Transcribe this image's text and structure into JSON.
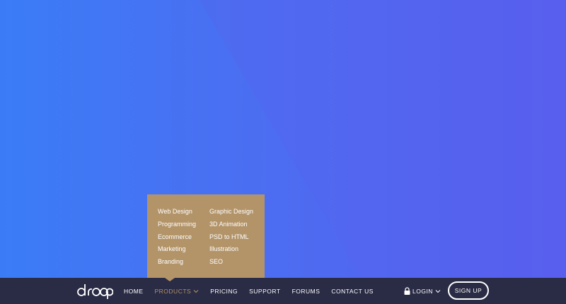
{
  "colors": {
    "background_start": "#3b7cf6",
    "background_end": "#5a5cee",
    "navbar": "#2a2b45",
    "dropdown": "#b39469",
    "accent": "#b39469",
    "text": "#ffffff"
  },
  "brand": {
    "logo_text": "droop"
  },
  "nav": {
    "items": [
      {
        "label": "HOME",
        "active": false
      },
      {
        "label": "PRODUCTS",
        "active": true,
        "icon": "chevron-down-icon"
      },
      {
        "label": "PRICING",
        "active": false
      },
      {
        "label": "SUPPORT",
        "active": false
      },
      {
        "label": "FORUMS",
        "active": false
      },
      {
        "label": "CONTACT US",
        "active": false
      }
    ],
    "login_label": "LOGIN",
    "login_icon": "lock-icon",
    "signup_label": "SIGN UP"
  },
  "dropdown": {
    "left_column": [
      "Web Design",
      "Programming",
      "Ecommerce",
      "Marketing",
      "Branding"
    ],
    "right_column": [
      "Graphic Design",
      "3D Animation",
      "PSD to HTML",
      "Illustration",
      "SEO"
    ]
  }
}
